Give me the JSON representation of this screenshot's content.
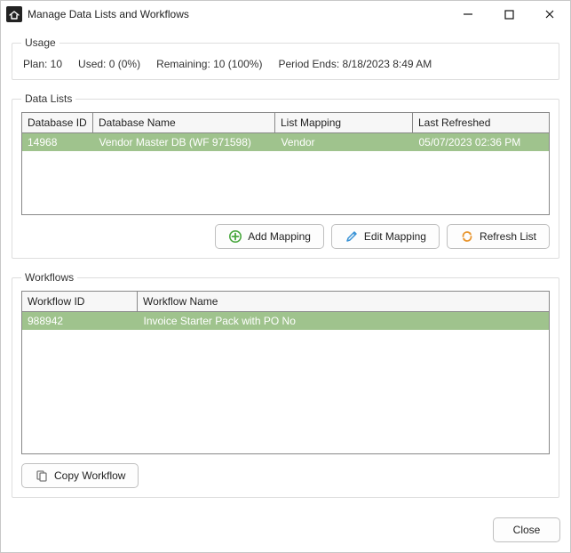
{
  "window": {
    "title": "Manage Data Lists and Workflows"
  },
  "usage": {
    "legend": "Usage",
    "plan": "Plan: 10",
    "used": "Used: 0 (0%)",
    "remaining": "Remaining: 10 (100%)",
    "period_ends": "Period Ends: 8/18/2023 8:49 AM"
  },
  "datalists": {
    "legend": "Data Lists",
    "headers": {
      "id": "Database ID",
      "name": "Database Name",
      "mapping": "List Mapping",
      "refreshed": "Last Refreshed"
    },
    "rows": [
      {
        "id": "14968",
        "name": "Vendor Master DB (WF 971598)",
        "mapping": "Vendor",
        "refreshed": "05/07/2023 02:36 PM"
      }
    ],
    "buttons": {
      "add": "Add Mapping",
      "edit": "Edit Mapping",
      "refresh": "Refresh List"
    }
  },
  "workflows": {
    "legend": "Workflows",
    "headers": {
      "id": "Workflow ID",
      "name": "Workflow Name"
    },
    "rows": [
      {
        "id": "988942",
        "name": "Invoice Starter Pack with PO No"
      }
    ],
    "buttons": {
      "copy": "Copy Workflow"
    }
  },
  "footer": {
    "close": "Close"
  }
}
